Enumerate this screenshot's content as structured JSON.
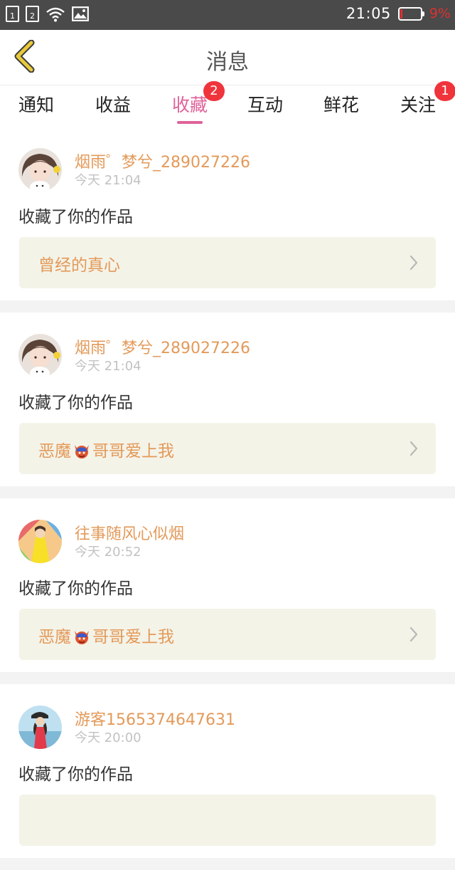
{
  "status_bar": {
    "sim1": "1",
    "sim2": "2",
    "time": "21:05",
    "battery_percent_text": "9%",
    "battery_level": 0.09,
    "icons": [
      "sim-card-icon",
      "sim-card-icon",
      "wifi-icon",
      "image-icon",
      "battery-icon"
    ]
  },
  "header": {
    "title": "消息",
    "back_icon": "chevron-left-icon"
  },
  "tabs": [
    {
      "label": "通知",
      "active": false,
      "badge": ""
    },
    {
      "label": "收益",
      "active": false,
      "badge": ""
    },
    {
      "label": "收藏",
      "active": true,
      "badge": "2"
    },
    {
      "label": "互动",
      "active": false,
      "badge": ""
    },
    {
      "label": "鲜花",
      "active": false,
      "badge": ""
    },
    {
      "label": "关注",
      "active": false,
      "badge": "1"
    }
  ],
  "colors": {
    "accent": "#e0629a",
    "username": "#e39a5a",
    "badge": "#f0343c",
    "work_bg": "#f4f3e8",
    "back_icon": "#e8c93a"
  },
  "feed": [
    {
      "username": "烟雨゜梦兮_289027226",
      "time": "今天 21:04",
      "action": "收藏了你的作品",
      "work_title": {
        "before": "曾经的真心",
        "emoji": "",
        "after": ""
      }
    },
    {
      "username": "烟雨゜梦兮_289027226",
      "time": "今天 21:04",
      "action": "收藏了你的作品",
      "work_title": {
        "before": "恶魔",
        "emoji": "devil-emoji",
        "after": "哥哥爱上我"
      }
    },
    {
      "username": "往事随风心似烟",
      "time": "今天 20:52",
      "action": "收藏了你的作品",
      "work_title": {
        "before": "恶魔",
        "emoji": "devil-emoji",
        "after": "哥哥爱上我"
      }
    },
    {
      "username": "游客1565374647631",
      "time": "今天 20:00",
      "action": "收藏了你的作品",
      "work_title": {
        "before": "",
        "emoji": "",
        "after": ""
      }
    }
  ]
}
